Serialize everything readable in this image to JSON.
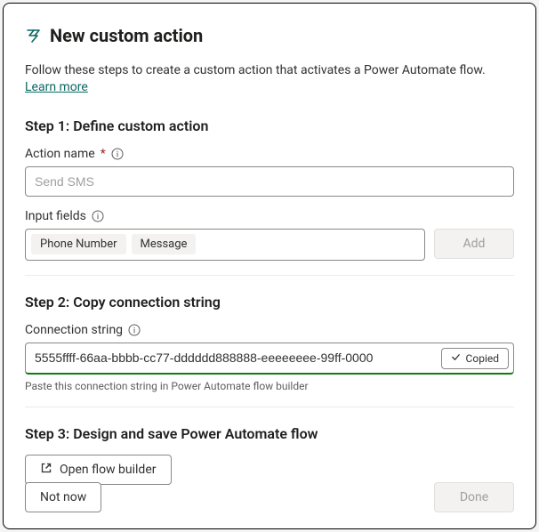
{
  "header": {
    "title": "New custom action"
  },
  "description": {
    "text": "Follow these steps to create a custom action that activates a Power Automate flow. ",
    "learn_more": "Learn more"
  },
  "step1": {
    "heading": "Step 1: Define custom action",
    "action_name_label": "Action name",
    "action_name_placeholder": "Send SMS",
    "input_fields_label": "Input fields",
    "tags": {
      "0": "Phone Number",
      "1": "Message"
    },
    "add_label": "Add"
  },
  "step2": {
    "heading": "Step 2: Copy connection string",
    "conn_label": "Connection string",
    "conn_value": "5555ffff-66aa-bbbb-cc77-dddddd888888-eeeeeeee-99ff-0000",
    "copied_label": "Copied",
    "hint": "Paste this connection string in Power Automate flow builder"
  },
  "step3": {
    "heading": "Step 3: Design and save Power Automate flow",
    "open_builder": "Open flow builder"
  },
  "footer": {
    "not_now": "Not now",
    "done": "Done"
  }
}
